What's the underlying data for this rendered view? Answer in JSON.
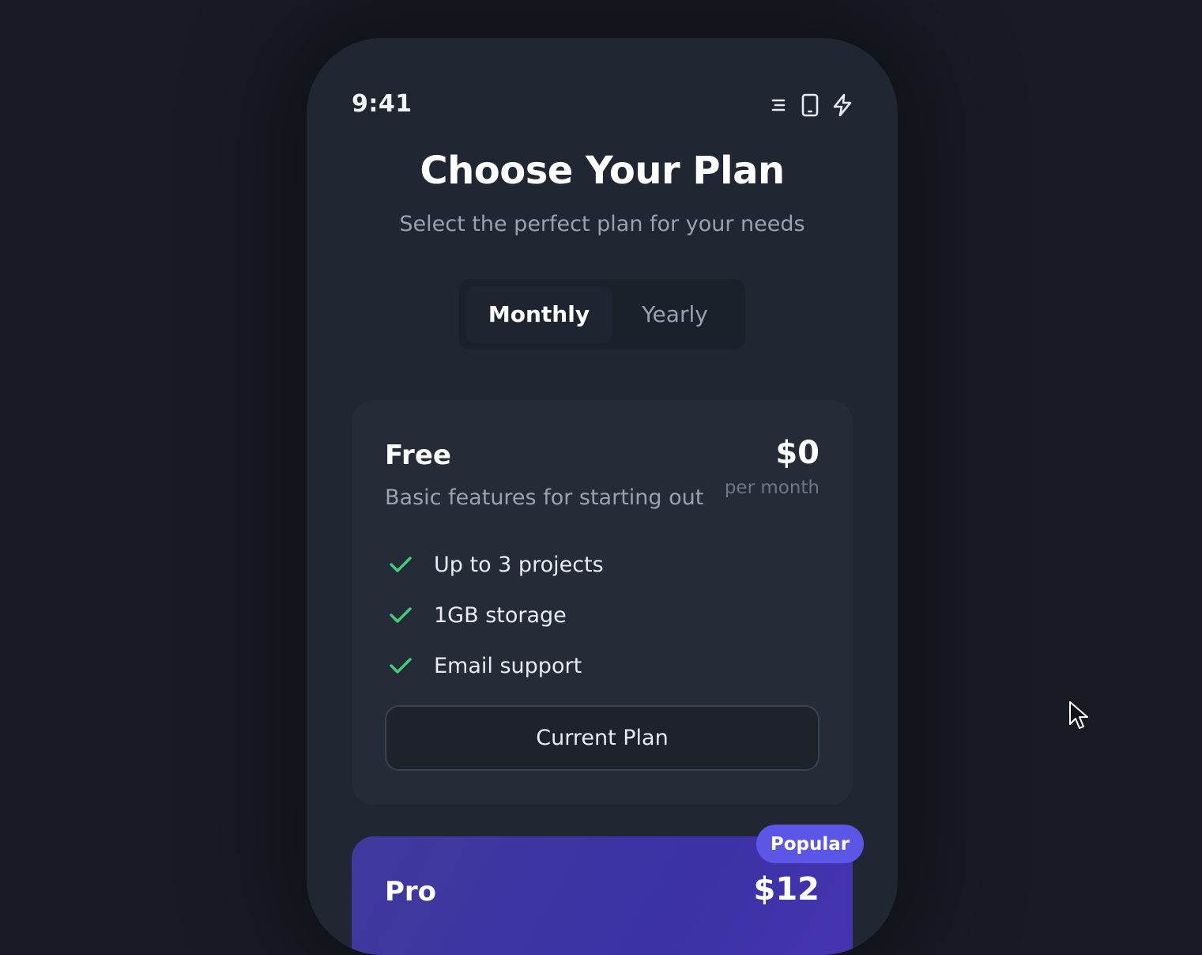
{
  "status": {
    "time": "9:41",
    "icons": [
      "menu-lines-icon",
      "phone-icon",
      "lightning-icon"
    ]
  },
  "header": {
    "title": "Choose Your Plan",
    "subtitle": "Select the perfect plan for your needs"
  },
  "billing_toggle": {
    "options": [
      {
        "label": "Monthly",
        "selected": true
      },
      {
        "label": "Yearly",
        "selected": false
      }
    ]
  },
  "plans": [
    {
      "name": "Free",
      "description": "Basic features for starting out",
      "price": "$0",
      "period": "per month",
      "features": [
        "Up to 3 projects",
        "1GB storage",
        "Email support"
      ],
      "button_label": "Current Plan"
    },
    {
      "name": "Pro",
      "price": "$12",
      "badge": "Popular"
    }
  ],
  "colors": {
    "background": "#181b24",
    "device": "#202632",
    "card": "#252b37",
    "check": "#3ecf7a",
    "accent": "#5c56e6",
    "pro_card": "#3b32a6"
  }
}
